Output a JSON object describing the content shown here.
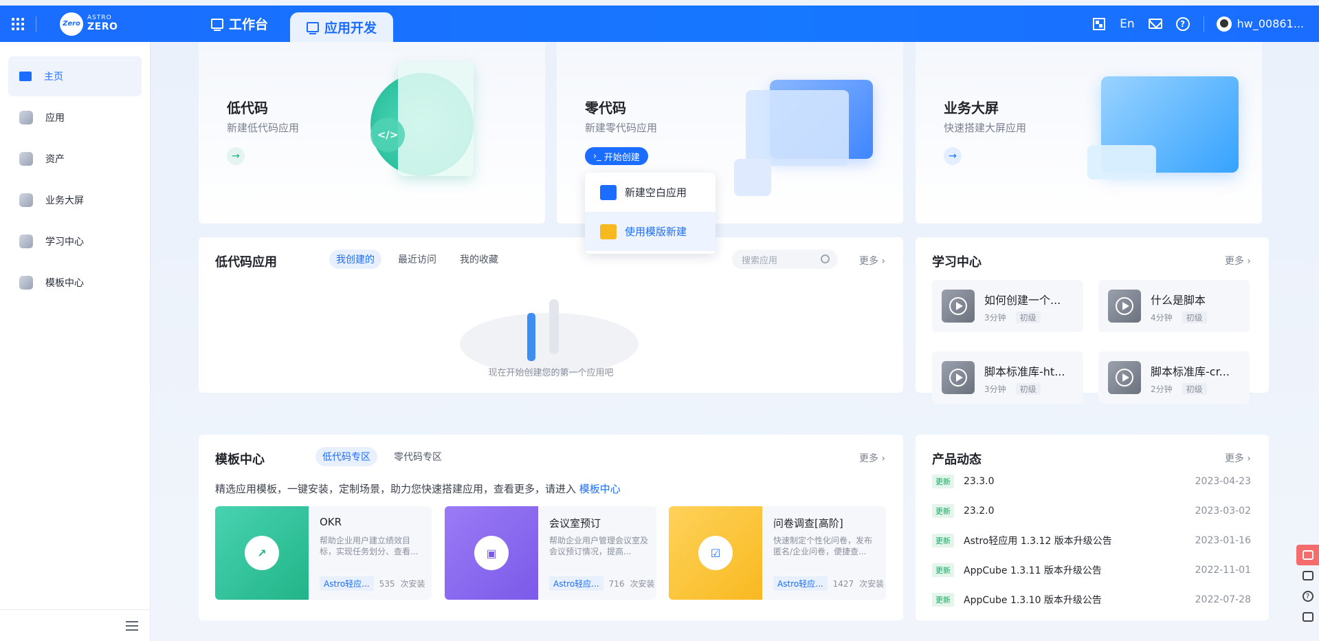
{
  "topbar": {
    "logo_small": "ASTRO",
    "logo_big": "ZERO",
    "logo_badge": "Zero",
    "tabs": [
      {
        "label": "工作台"
      },
      {
        "label": "应用开发"
      }
    ],
    "lang": "En",
    "username": "hw_00861..."
  },
  "sidebar": {
    "items": [
      {
        "label": "主页"
      },
      {
        "label": "应用"
      },
      {
        "label": "资产"
      },
      {
        "label": "业务大屏"
      },
      {
        "label": "学习中心"
      },
      {
        "label": "模板中心"
      }
    ]
  },
  "hero": {
    "cards": [
      {
        "title": "低代码",
        "subtitle": "新建低代码应用"
      },
      {
        "title": "零代码",
        "subtitle": "新建零代码应用",
        "button": "开始创建"
      },
      {
        "title": "业务大屏",
        "subtitle": "快速搭建大屏应用"
      }
    ]
  },
  "dropdown": {
    "items": [
      {
        "label": "新建空白应用"
      },
      {
        "label": "使用模版新建"
      }
    ]
  },
  "lowcode": {
    "title": "低代码应用",
    "tabs": [
      "我创建的",
      "最近访问",
      "我的收藏"
    ],
    "search_placeholder": "搜索应用",
    "more": "更多",
    "empty_text": "现在开始创建您的第一个应用吧"
  },
  "learning": {
    "title": "学习中心",
    "more": "更多",
    "items": [
      {
        "title": "如何创建一个...",
        "duration": "3分钟",
        "level": "初级"
      },
      {
        "title": "什么是脚本",
        "duration": "4分钟",
        "level": "初级"
      },
      {
        "title": "脚本标准库-ht...",
        "duration": "3分钟",
        "level": "初级"
      },
      {
        "title": "脚本标准库-cr...",
        "duration": "2分钟",
        "level": "初级"
      }
    ]
  },
  "templates": {
    "title": "模板中心",
    "tabs": [
      "低代码专区",
      "零代码专区"
    ],
    "more": "更多",
    "intro": "精选应用模板，一键安装，定制场景，助力您快速搭建应用，查看更多，请进入",
    "intro_link": "模板中心",
    "items": [
      {
        "name": "OKR",
        "desc": "帮助企业用户建立绩效目标，实现任务划分、查看...",
        "vendor": "Astro轻应...",
        "installs": "535",
        "installs_unit": "次安装",
        "color": "#2fc3a0"
      },
      {
        "name": "会议室预订",
        "desc": "帮助企业用户管理会议室及会议预订情况，提高...",
        "vendor": "Astro轻应...",
        "installs": "716",
        "installs_unit": "次安装",
        "color": "#8b6cf0"
      },
      {
        "name": "问卷调查[高阶]",
        "desc": "快速制定个性化问卷，发布匿名/企业问卷，便捷查...",
        "vendor": "Astro轻应...",
        "installs": "1427",
        "installs_unit": "次安装",
        "color": "#fbc531"
      }
    ]
  },
  "news": {
    "title": "产品动态",
    "more": "更多",
    "tag": "更新",
    "items": [
      {
        "title": "23.3.0",
        "date": "2023-04-23"
      },
      {
        "title": "23.2.0",
        "date": "2023-03-02"
      },
      {
        "title": "Astro轻应用 1.3.12 版本升级公告",
        "date": "2023-01-16"
      },
      {
        "title": "AppCube 1.3.11 版本升级公告",
        "date": "2022-11-01"
      },
      {
        "title": "AppCube 1.3.10 版本升级公告",
        "date": "2022-07-28"
      }
    ]
  },
  "colors": {
    "brand": "#1a6dff",
    "update_tag": "#20a565"
  }
}
